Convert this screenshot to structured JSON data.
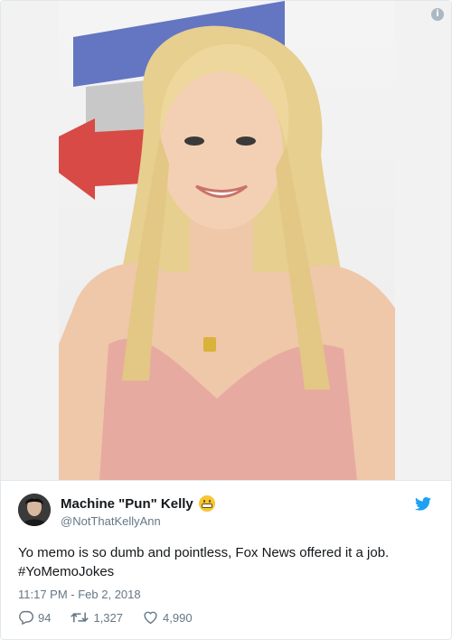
{
  "media": {
    "info_label": "i"
  },
  "tweet": {
    "display_name": "Machine \"Pun\" Kelly",
    "emoji": "grimacing-face",
    "handle": "@NotThatKellyAnn",
    "text_line1": "Yo memo is so dumb and pointless, Fox News offered it a job.",
    "text_line2": "#YoMemoJokes",
    "timestamp": "11:17 PM - Feb 2, 2018",
    "replies": "94",
    "retweets": "1,327",
    "likes": "4,990"
  },
  "colors": {
    "twitter_blue": "#1da1f2",
    "meta_gray": "#657786",
    "text": "#14171a",
    "border": "#e1e8ed"
  },
  "icons": [
    "info-icon",
    "twitter-bird-icon",
    "reply-icon",
    "retweet-icon",
    "like-icon"
  ]
}
